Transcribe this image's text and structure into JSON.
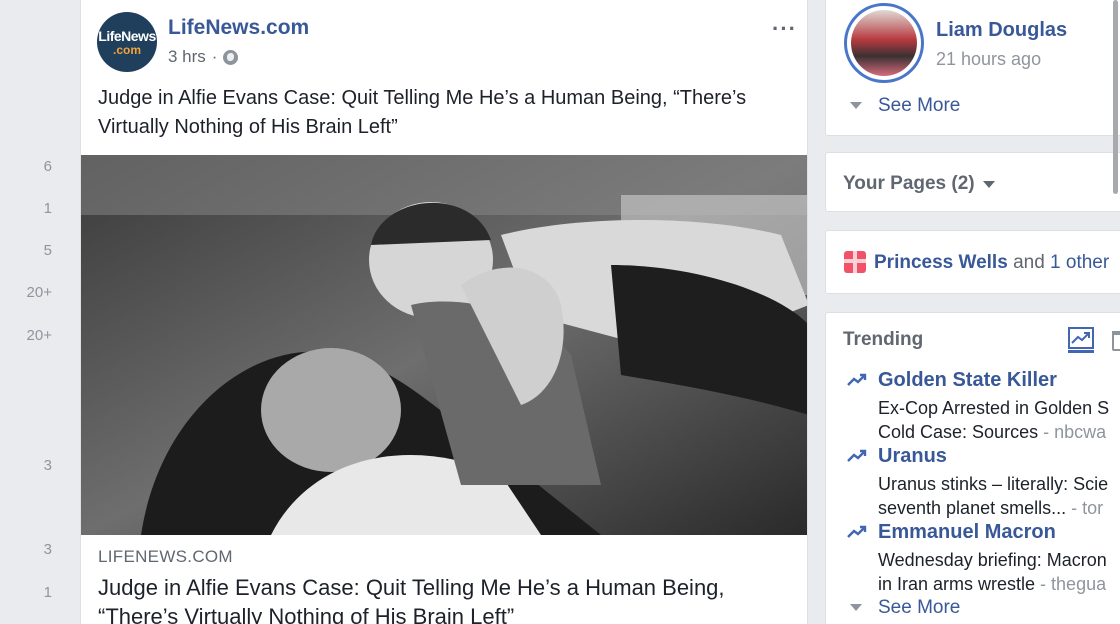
{
  "feed_counts": [
    "6",
    "1",
    "5",
    "20+",
    "20+",
    "3",
    "3",
    "1"
  ],
  "post": {
    "page_name": "LifeNews.com",
    "avatar_line1": "LifeNews",
    "avatar_line2": ".com",
    "time": "3 hrs",
    "separator": "·",
    "privacy_icon": "globe-icon",
    "more_label": "···",
    "text_line1": "Judge in Alfie Evans Case: Quit Telling Me He’s a Human Being, “There’s",
    "text_line2": "Virtually Nothing of His Brain Left”",
    "link_domain": "LIFENEWS.COM",
    "link_title_line1": "Judge in Alfie Evans Case: Quit Telling Me He’s a Human Being,",
    "link_title_line2": "“There’s Virtually Nothing of His Brain Left”"
  },
  "profile": {
    "name": "Liam Douglas",
    "time": "21 hours ago",
    "see_more": "See More"
  },
  "pages": {
    "label": "Your Pages (2)"
  },
  "birthday": {
    "icon": "gift-icon",
    "name": "Princess Wells",
    "and": "and",
    "other": "1 other"
  },
  "trending": {
    "title": "Trending",
    "tab_icon": "trending-icon",
    "items": [
      {
        "name": "Golden State Killer",
        "line1": "Ex-Cop Arrested in Golden S",
        "line2": "Cold Case: Sources",
        "source": " - nbcwa"
      },
      {
        "name": "Uranus",
        "line1": "Uranus stinks – literally: Scie",
        "line2": "seventh planet smells...",
        "source": " - tor"
      },
      {
        "name": "Emmanuel Macron",
        "line1": "Wednesday briefing: Macron",
        "line2": "in Iran arms wrestle",
        "source": " - thegua"
      }
    ],
    "see_more": "See More"
  }
}
